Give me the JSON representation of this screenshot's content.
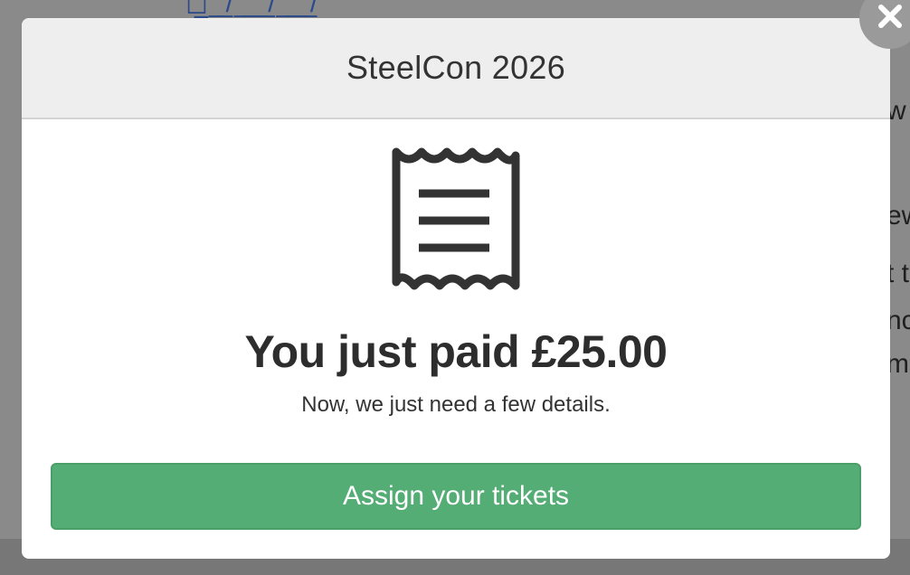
{
  "modal": {
    "title": "SteelCon 2026",
    "headline": "You just paid £25.00",
    "subtext": "Now, we just need a few details.",
    "primary_button_label": "Assign your tickets",
    "receipt_icon": "receipt-icon",
    "close_icon": "close-icon"
  },
  "background": {
    "partial_text": [
      "w",
      "ew",
      "t t",
      "nc",
      "m"
    ]
  },
  "colors": {
    "button": "#54ad74",
    "header": "#eeeeee",
    "overlay": "#8a8a8a"
  }
}
